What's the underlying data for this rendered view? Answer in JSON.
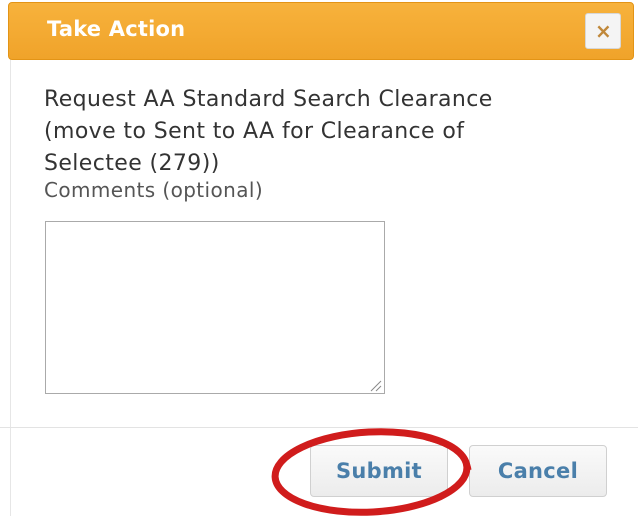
{
  "dialog": {
    "title": "Take Action",
    "close_label": "×",
    "description": "Request AA Standard Search Clearance (move to Sent to AA for Clearance of Selectee (279))",
    "comments_label": "Comments (optional)",
    "comments_value": "",
    "submit_label": "Submit",
    "cancel_label": "Cancel"
  },
  "colors": {
    "titlebar": "#f0a32a",
    "title_text": "#ffffff",
    "button_text": "#4a7faa",
    "annotation_circle": "#d01c1c"
  }
}
